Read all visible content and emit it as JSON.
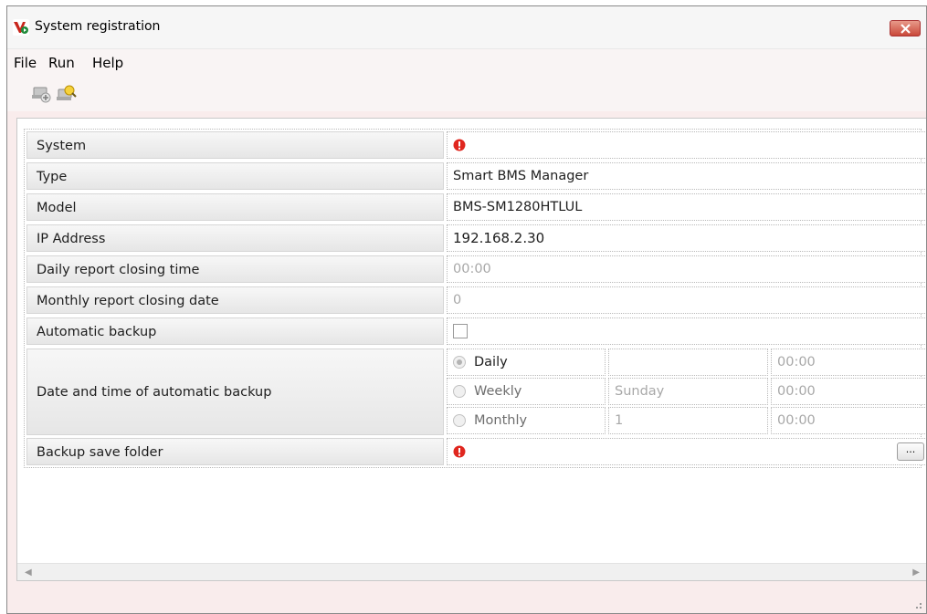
{
  "window": {
    "title": "System registration",
    "icon": "app-logo-icon"
  },
  "menu": {
    "file": "File",
    "run": "Run",
    "help": "Help"
  },
  "toolbar": {
    "icons": [
      "add-system-icon",
      "search-system-icon"
    ]
  },
  "rows": {
    "system": {
      "label": "System",
      "value": "",
      "status": "error"
    },
    "type": {
      "label": "Type",
      "value": "Smart BMS Manager"
    },
    "model": {
      "label": "Model",
      "value": "BMS-SM1280HTLUL"
    },
    "ip": {
      "label": "IP Address",
      "value": "192.168.2.30"
    },
    "daily": {
      "label": "Daily report closing time",
      "value": "00:00"
    },
    "monthly": {
      "label": "Monthly report closing date",
      "value": "0"
    },
    "autobackup": {
      "label": "Automatic backup",
      "checked": false
    },
    "schedule": {
      "label": "Date and time of automatic backup",
      "options": [
        {
          "label": "Daily",
          "param": "",
          "time": "00:00",
          "selected": true
        },
        {
          "label": "Weekly",
          "param": "Sunday",
          "time": "00:00",
          "selected": false
        },
        {
          "label": "Monthly",
          "param": "1",
          "time": "00:00",
          "selected": false
        }
      ]
    },
    "folder": {
      "label": "Backup save folder",
      "value": "",
      "status": "error",
      "browse": "..."
    }
  },
  "colors": {
    "error": "#e0271f",
    "window_bg": "#f9ecec"
  }
}
